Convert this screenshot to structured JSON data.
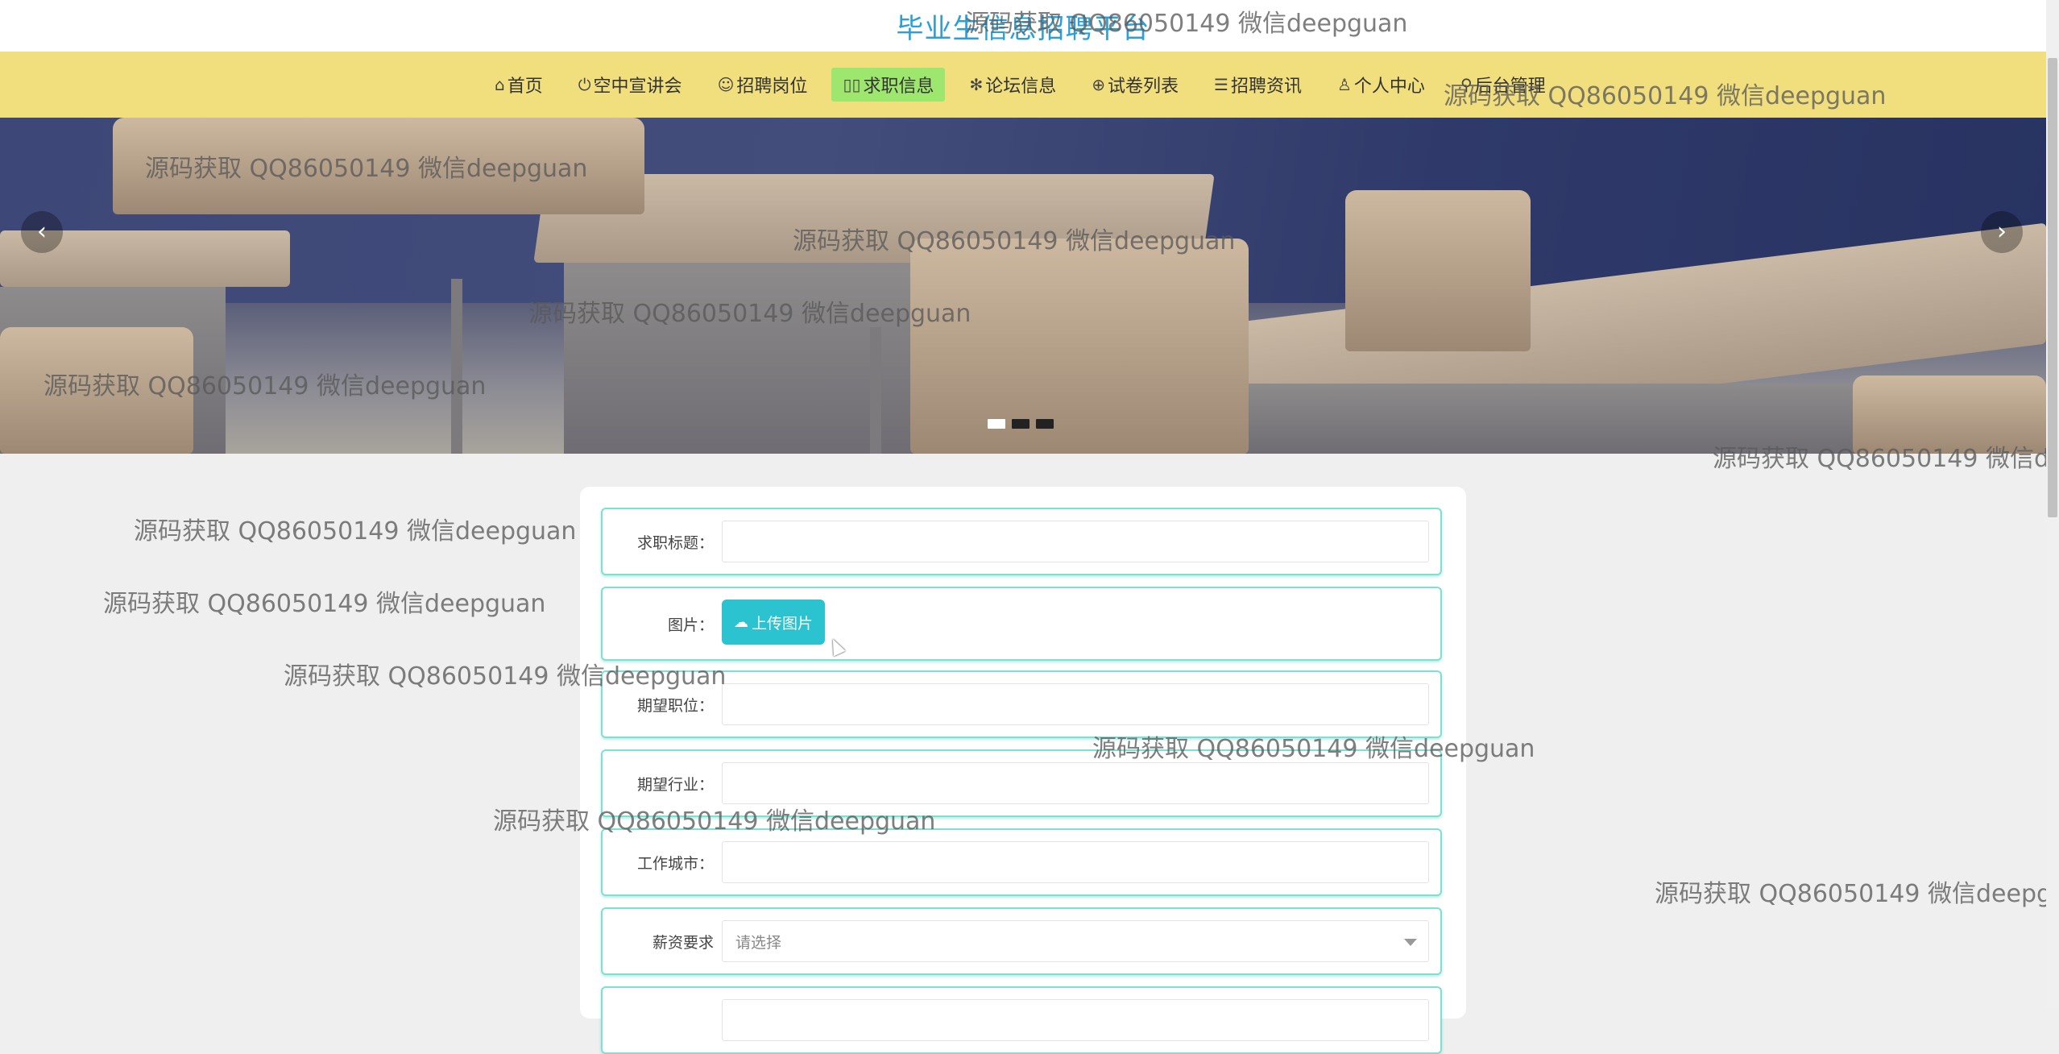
{
  "site": {
    "title": "毕业生信息招聘平台"
  },
  "nav": {
    "items": [
      {
        "icon": "⌂",
        "label": "首页",
        "icon_name": "home-icon"
      },
      {
        "icon": "⏻",
        "label": "空中宣讲会",
        "icon_name": "power-icon"
      },
      {
        "icon": "☺",
        "label": "招聘岗位",
        "icon_name": "face-icon"
      },
      {
        "icon": "▯▯",
        "label": "求职信息",
        "icon_name": "resume-icon",
        "active": true
      },
      {
        "icon": "✻",
        "label": "论坛信息",
        "icon_name": "asterisk-icon"
      },
      {
        "icon": "⊕",
        "label": "试卷列表",
        "icon_name": "globe-icon"
      },
      {
        "icon": "☰",
        "label": "招聘资讯",
        "icon_name": "sliders-icon"
      },
      {
        "icon": "♙",
        "label": "个人中心",
        "icon_name": "user-icon"
      },
      {
        "icon": "⚲",
        "label": "后台管理",
        "icon_name": "link-icon"
      }
    ]
  },
  "carousel": {
    "prev": "‹",
    "next": "›",
    "slide_count": 3,
    "active_index": 0
  },
  "form": {
    "title_label": "求职标题：",
    "image_label": "图片：",
    "upload_label": "上传图片",
    "position_label": "期望职位：",
    "industry_label": "期望行业：",
    "city_label": "工作城市：",
    "salary_label": "薪资要求",
    "salary_placeholder": "请选择"
  },
  "watermark": {
    "text": "源码获取 QQ86050149 微信deepguan"
  },
  "colors": {
    "nav_bg": "#f1df7e",
    "nav_active": "#9ee76f",
    "title": "#2a9fd8",
    "accent": "#2ac3cf",
    "field_border": "#7ee0d2"
  }
}
